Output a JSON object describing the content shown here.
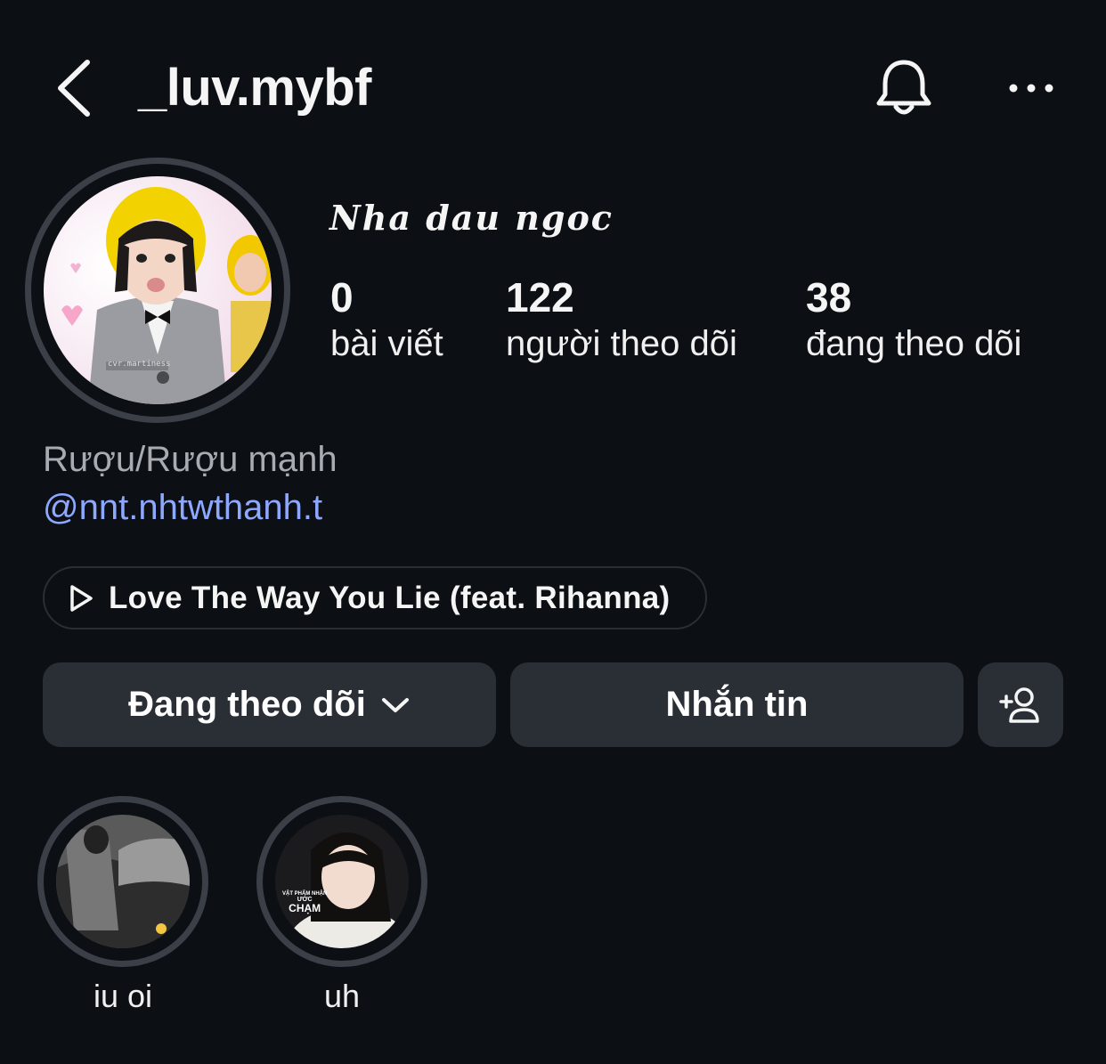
{
  "header": {
    "username": "_luv.mybf",
    "back_icon": "chevron-left-icon",
    "bell_icon": "bell-icon",
    "more_icon": "more-horizontal-icon"
  },
  "profile": {
    "display_name": "Nha dau ngoc",
    "stats": [
      {
        "value": "0",
        "label": "bài viết"
      },
      {
        "value": "122",
        "label": "người theo dõi"
      },
      {
        "value": "38",
        "label": "đang theo dõi"
      }
    ],
    "category": "Rượu/Rượu mạnh",
    "mention": "@nnt.nhtwthanh.t",
    "avatar_caption": "cvr.martiness"
  },
  "music": {
    "icon": "play-icon",
    "title": "Love The Way You Lie (feat. Rihanna)"
  },
  "actions": {
    "following_label": "Đang theo dõi",
    "message_label": "Nhắn tin",
    "add_user_icon": "add-user-icon"
  },
  "highlights": [
    {
      "label": "iu oi"
    },
    {
      "label": "uh",
      "overlay_line1": "VẬT PHẨM NHẬN",
      "overlay_line2": "ƯỚC",
      "overlay_line3": "CHẠM"
    }
  ],
  "colors": {
    "background": "#0c0f14",
    "button": "#2a2e35",
    "mention": "#8fa8ff",
    "secondary_text": "#a8abb2"
  }
}
